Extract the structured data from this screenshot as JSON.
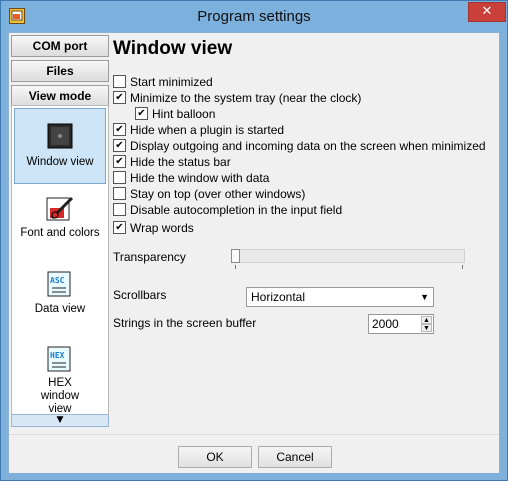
{
  "window": {
    "title": "Program settings",
    "close_glyph": "✕"
  },
  "sidebar": {
    "sections": [
      "COM port",
      "Files",
      "View mode"
    ],
    "pages": [
      {
        "label": "Window view",
        "icon": "window-view-icon"
      },
      {
        "label": "Font and colors",
        "icon": "font-colors-icon"
      },
      {
        "label": "Data view",
        "icon": "asc-data-icon",
        "icon_text": "ASC"
      },
      {
        "label": "HEX window view",
        "icon": "hex-window-icon",
        "icon_text": "HEX"
      }
    ],
    "scroll_glyph": "▼"
  },
  "main": {
    "heading": "Window view",
    "options": [
      {
        "label": "Start minimized",
        "checked": false
      },
      {
        "label": "Minimize to the system tray (near the clock)",
        "checked": true
      },
      {
        "label": "Hint balloon",
        "checked": true
      },
      {
        "label": "Hide when a plugin is started",
        "checked": true
      },
      {
        "label": "Display outgoing and incoming data on the screen when minimized",
        "checked": true
      },
      {
        "label": "Hide the status bar",
        "checked": true
      },
      {
        "label": "Hide the window with data",
        "checked": false
      },
      {
        "label": "Stay on top (over other windows)",
        "checked": false
      },
      {
        "label": "Disable autocompletion in the input field",
        "checked": false
      },
      {
        "label": "Wrap words",
        "checked": true
      }
    ],
    "transparency_label": "Transparency",
    "transparency_value": 0,
    "scrollbars_label": "Scrollbars",
    "scrollbars_value": "Horizontal",
    "buffer_label": "Strings in the screen buffer",
    "buffer_value": "2000"
  },
  "footer": {
    "ok": "OK",
    "cancel": "Cancel"
  },
  "colors": {
    "titlebar": "#7cb0dd",
    "close": "#c9403a",
    "selected_page": "#cde5f7"
  }
}
